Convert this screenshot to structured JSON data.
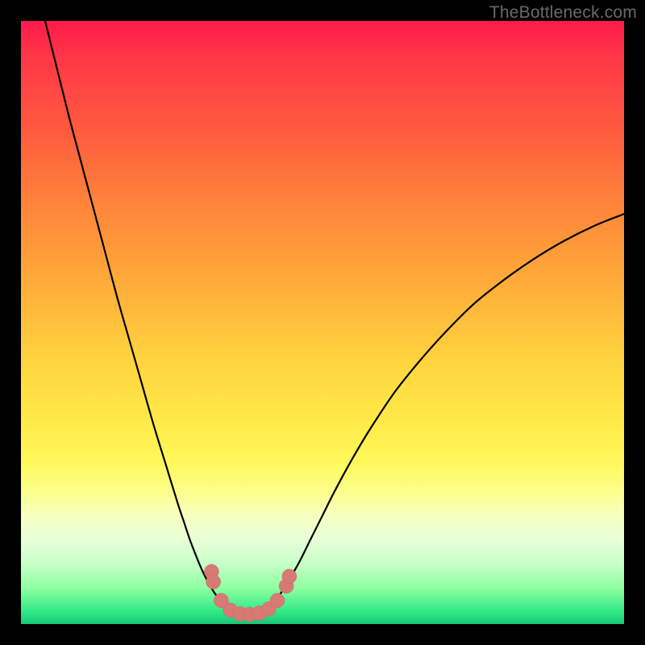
{
  "watermark": "TheBottleneck.com",
  "colors": {
    "frame": "#000000",
    "curve": "#000000",
    "marker_fill": "#d87a74",
    "marker_stroke": "#c96863"
  },
  "chart_data": {
    "type": "line",
    "title": "",
    "xlabel": "",
    "ylabel": "",
    "xlim": [
      0,
      100
    ],
    "ylim": [
      0,
      100
    ],
    "note": "Values estimated from pixel positions; chart has no visible axis ticks or numeric labels. x is horizontal position (0=left edge of plot, 100=right). y approximates bottleneck percentage implied by the color gradient (0=green baseline, 100=top red).",
    "series": [
      {
        "name": "left-branch",
        "x": [
          4.0,
          6.0,
          8.0,
          10.0,
          12.0,
          14.0,
          16.0,
          18.0,
          20.0,
          22.0,
          24.0,
          26.0,
          27.0,
          28.0,
          29.0,
          30.0,
          31.0,
          32.0,
          33.0,
          34.0,
          35.0,
          36.0,
          37.0
        ],
        "y": [
          100.0,
          92.0,
          84.0,
          76.5,
          69.0,
          61.5,
          54.0,
          47.0,
          40.0,
          33.0,
          26.5,
          20.0,
          17.0,
          14.0,
          11.4,
          9.0,
          7.0,
          5.3,
          4.0,
          3.0,
          2.3,
          1.9,
          1.7
        ]
      },
      {
        "name": "valley-floor",
        "x": [
          33.0,
          34.0,
          35.0,
          36.0,
          37.0,
          38.0,
          39.0,
          40.0,
          41.0,
          42.0,
          43.0
        ],
        "y": [
          4.0,
          3.0,
          2.3,
          1.9,
          1.7,
          1.7,
          1.8,
          2.1,
          2.7,
          3.6,
          5.0
        ]
      },
      {
        "name": "right-branch",
        "x": [
          40.0,
          41.0,
          42.0,
          43.0,
          44.0,
          46.0,
          48.0,
          50.0,
          52.0,
          55.0,
          58.0,
          62.0,
          66.0,
          70.0,
          75.0,
          80.0,
          85.0,
          90.0,
          95.0,
          100.0
        ],
        "y": [
          2.1,
          2.7,
          3.6,
          5.0,
          6.6,
          10.0,
          14.0,
          18.0,
          22.0,
          27.5,
          32.5,
          38.5,
          43.5,
          48.0,
          53.0,
          57.0,
          60.5,
          63.5,
          66.0,
          68.0
        ]
      }
    ],
    "markers": {
      "name": "valley-markers",
      "note": "Salmon-colored dots clustered near the valley minimum",
      "points": [
        {
          "x": 31.6,
          "y": 8.7
        },
        {
          "x": 31.9,
          "y": 7.0
        },
        {
          "x": 33.2,
          "y": 3.9
        },
        {
          "x": 34.7,
          "y": 2.3
        },
        {
          "x": 36.3,
          "y": 1.7
        },
        {
          "x": 37.9,
          "y": 1.6
        },
        {
          "x": 39.5,
          "y": 1.8
        },
        {
          "x": 41.1,
          "y": 2.5
        },
        {
          "x": 42.5,
          "y": 3.9
        },
        {
          "x": 44.0,
          "y": 6.3
        },
        {
          "x": 44.5,
          "y": 7.9
        }
      ],
      "radius": 1.2
    }
  }
}
